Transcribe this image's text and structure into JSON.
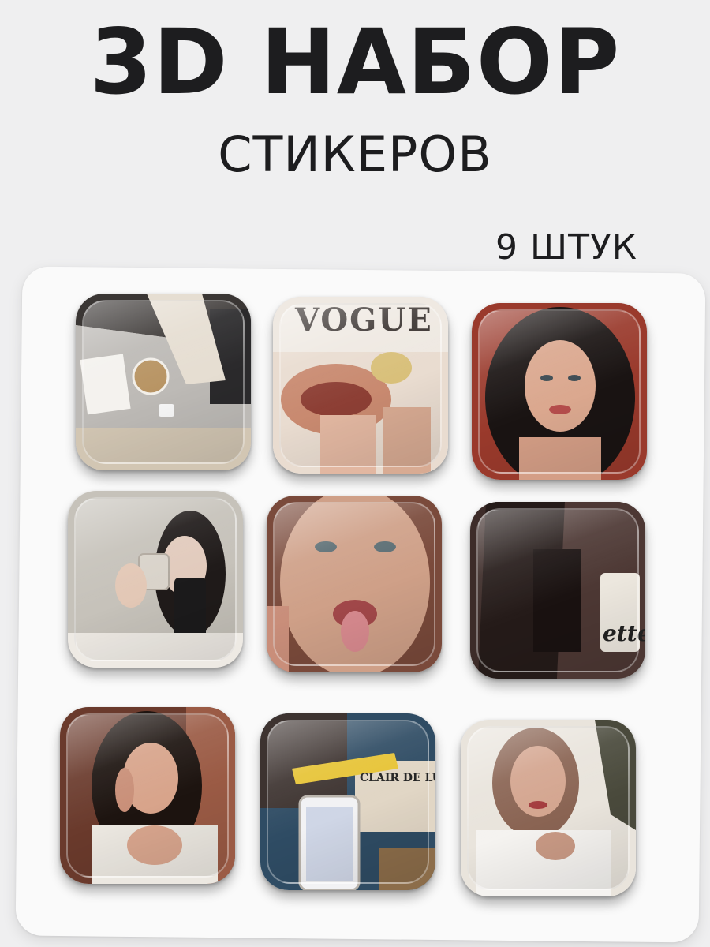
{
  "header": {
    "title": "3D НАБОР",
    "subtitle": "СТИКЕРОВ",
    "count": "9 ШТУК"
  },
  "stickers": [
    {
      "id": 1,
      "subject": "desk with iced coffee and laptop",
      "palette": [
        "#cfc7bd",
        "#8f8a86",
        "#2c2a29"
      ]
    },
    {
      "id": 2,
      "subject": "magazine cover with lips",
      "label": "VOGUE",
      "palette": [
        "#e8d7c9",
        "#c98c72",
        "#3b3330"
      ]
    },
    {
      "id": 3,
      "subject": "portrait woman dark hair",
      "palette": [
        "#9c3b2c",
        "#1b1514",
        "#d9a78e"
      ]
    },
    {
      "id": 4,
      "subject": "mirror selfie with phone",
      "palette": [
        "#bdb8b0",
        "#1f1c1b",
        "#e3cdbd"
      ]
    },
    {
      "id": 5,
      "subject": "close-up face",
      "palette": [
        "#caa089",
        "#7c4b3c",
        "#e4c5b4"
      ]
    },
    {
      "id": 6,
      "subject": "woman in leather jacket with coffee",
      "label": "ette",
      "palette": [
        "#4a3632",
        "#1e1716",
        "#e9e3da"
      ]
    },
    {
      "id": 7,
      "subject": "woman on phone",
      "palette": [
        "#6b3b2e",
        "#1e1512",
        "#d9a58c"
      ]
    },
    {
      "id": 8,
      "subject": "collage with phone and mascara",
      "label": "CLAIR DE LUNE",
      "palette": [
        "#2f4f6a",
        "#e4c23b",
        "#d8cdbd"
      ]
    },
    {
      "id": 9,
      "subject": "woman with short hair white shirt",
      "palette": [
        "#e8e2d9",
        "#8a6553",
        "#c79c86"
      ]
    }
  ]
}
